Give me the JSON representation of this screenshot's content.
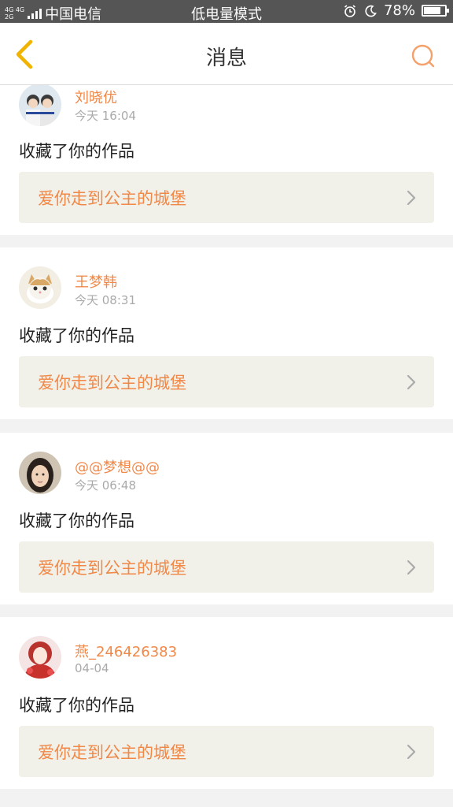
{
  "status_bar": {
    "network": [
      "4G 4G",
      "2G"
    ],
    "carrier": "中国电信",
    "mode": "低电量模式",
    "battery_percent": "78%",
    "battery_level": 0.78
  },
  "header": {
    "title": "消息"
  },
  "messages": [
    {
      "user": "刘晓优",
      "time": "今天 16:04",
      "action": "收藏了你的作品",
      "reference": "爱你走到公主的城堡"
    },
    {
      "user": "王梦韩",
      "time": "今天 08:31",
      "action": "收藏了你的作品",
      "reference": "爱你走到公主的城堡"
    },
    {
      "user": "@@梦想@@",
      "time": "今天 06:48",
      "action": "收藏了你的作品",
      "reference": "爱你走到公主的城堡"
    },
    {
      "user": "燕_246426383",
      "time": "04-04",
      "action": "收藏了你的作品",
      "reference": "爱你走到公主的城堡"
    }
  ],
  "colors": {
    "accent": "#f08848",
    "back_arrow": "#f0b400",
    "statusbar": "#555555",
    "ref_bg": "#f1f1ea"
  },
  "icons": {
    "back": "back-arrow-icon",
    "search": "search-icon",
    "chevron": "chevron-right-icon"
  }
}
